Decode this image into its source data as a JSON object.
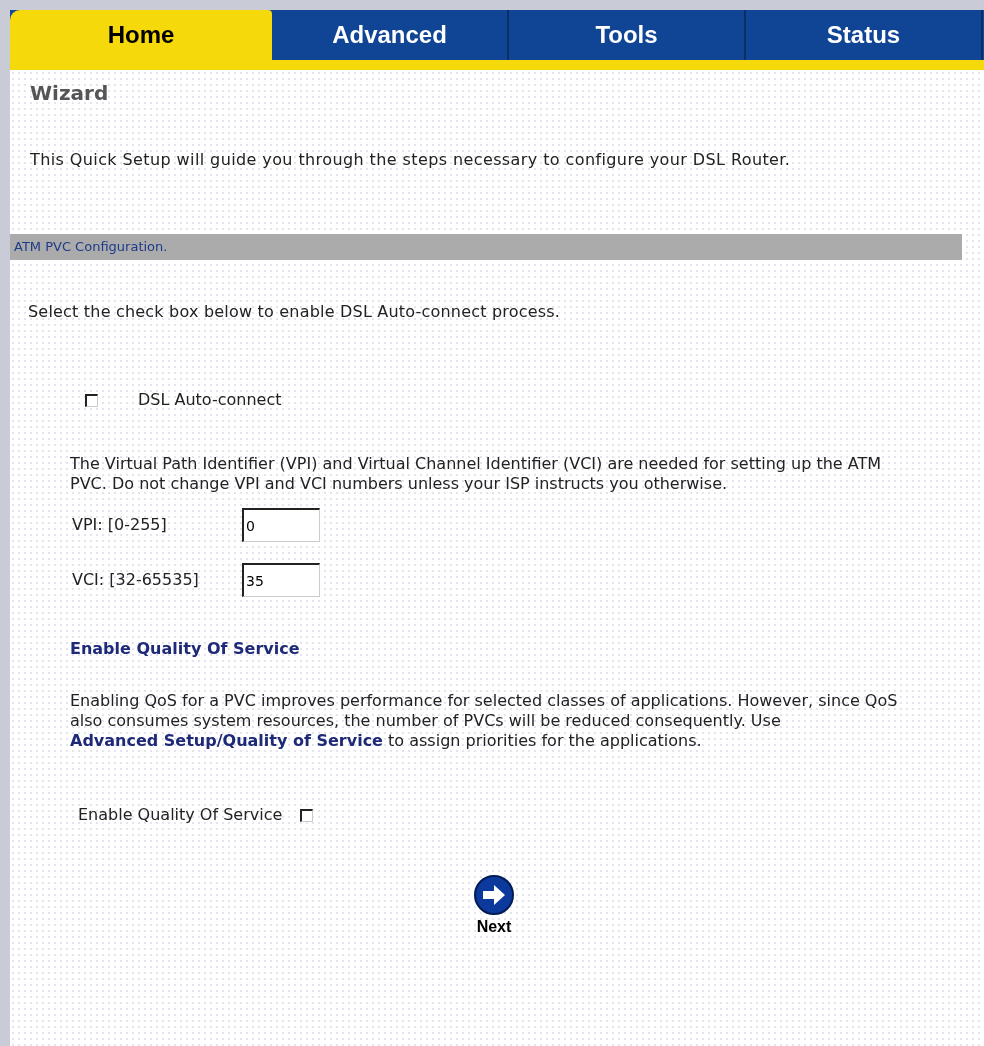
{
  "tabs": [
    {
      "label": "Home",
      "selected": true
    },
    {
      "label": "Advanced",
      "selected": false
    },
    {
      "label": "Tools",
      "selected": false
    },
    {
      "label": "Status",
      "selected": false
    }
  ],
  "page_title": "Wizard",
  "intro": "This Quick Setup will guide you through the steps necessary to configure your DSL Router.",
  "section_header": "ATM PVC Configuration.",
  "auto_connect_hint": "Select the check box below to enable DSL Auto-connect process.",
  "auto_connect": {
    "label": "DSL Auto-connect",
    "checked": false
  },
  "vpi_vci_note": "The Virtual Path Identifier (VPI) and Virtual Channel Identifier (VCI) are needed for setting up the ATM PVC. Do not change VPI and VCI numbers unless your ISP instructs you otherwise.",
  "fields": [
    {
      "label": "VPI: [0-255]",
      "value": "0"
    },
    {
      "label": "VCI: [32-65535]",
      "value": "35"
    }
  ],
  "qos_heading": "Enable Quality Of Service",
  "qos_note": {
    "before": "Enabling QoS for a PVC improves performance for selected classes of applications. However, since QoS also consumes system resources, the number of PVCs will be reduced consequently. Use ",
    "link": "Advanced Setup/Quality of Service",
    "after": " to assign priorities for the applications."
  },
  "qos_checkbox": {
    "label": "Enable Quality Of Service",
    "checked": false
  },
  "next_button": "Next"
}
